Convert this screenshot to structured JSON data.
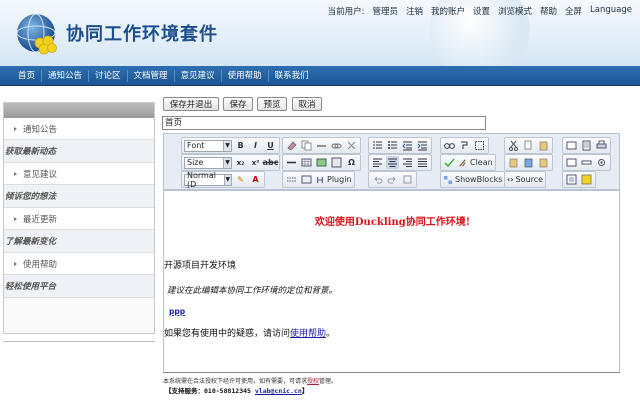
{
  "header": {
    "title": "协同工作环境套件",
    "top_links": [
      "当前用户:",
      "管理员",
      "注销",
      "我的账户",
      "设置",
      "浏览模式",
      "帮助",
      "全屏",
      "Language"
    ]
  },
  "main_nav": [
    "首页",
    "通知公告",
    "讨论区",
    "文档管理",
    "意见建议",
    "使用帮助",
    "联系我们"
  ],
  "sidebar": {
    "items": [
      {
        "label": "通知公告",
        "desc": "获取最新动态"
      },
      {
        "label": "意见建议",
        "desc": "倾诉您的想法"
      },
      {
        "label": "最近更新",
        "desc": "了解最新变化"
      },
      {
        "label": "使用帮助",
        "desc": "轻松使用平台"
      }
    ]
  },
  "actions": {
    "save_exit": "保存并退出",
    "save": "保存",
    "preview": "预览",
    "cancel": "取消"
  },
  "page_title_value": "首页",
  "toolbar": {
    "font_label": "Font",
    "size_label": "Size",
    "format_label": "Normal (D",
    "plugin_label": "Plugin",
    "clean_label": "Clean",
    "showblocks_label": "ShowBlocks",
    "source_label": "Source"
  },
  "editor": {
    "welcome": "欢迎使用Duckling协同工作环境!",
    "para1": "开源项目开发环境",
    "para2": "建议在此编辑本协同工作环境的定位和背景。",
    "link_ppp": "ppp",
    "para3_prefix": "如果您有使用中的疑惑，请访问",
    "para3_link": "使用帮助",
    "para3_suffix": "。"
  },
  "footer": {
    "line1_prefix": "本系统需在合法授权下经许可使用，如有需要，可请求",
    "line1_link": "授权",
    "line1_suffix": "管理。",
    "line2_prefix": "【支持服务：010-58812345 ",
    "line2_email": "vlab@cnic.cn",
    "line2_suffix": "】"
  },
  "colors": {
    "brand_blue": "#1d4f8e",
    "nav_blue": "#2d6fb2",
    "welcome_red": "#d8141a",
    "link_blue": "#1a1aa5"
  }
}
